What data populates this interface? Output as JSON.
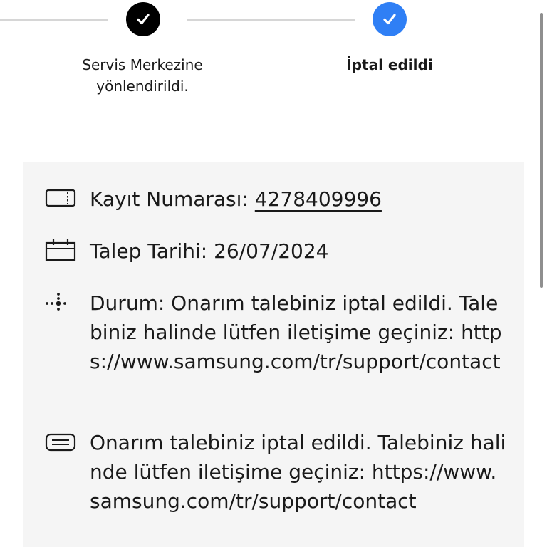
{
  "steps": [
    {
      "label_line1": "Servis Merkezine",
      "label_line2": "yönlendirildi.",
      "status": "completed"
    },
    {
      "label": "İptal edildi",
      "status": "current"
    }
  ],
  "info": {
    "record_label": "Kayıt Numarası: ",
    "record_number": "4278409996",
    "request_date": "Talep Tarihi: 26/07/2024",
    "status_text": "Durum: Onarım talebiniz iptal edildi. Talebiniz halinde lütfen iletişime geçiniz: https://www.samsung.com/tr/support/contact",
    "message_text": "Onarım talebiniz iptal edildi. Talebiniz halinde lütfen iletişime geçiniz: https://www.samsung.com/tr/support/contact"
  },
  "icons": [
    "ticket-icon",
    "calendar-icon",
    "status-dots-icon",
    "message-icon",
    "check-icon"
  ],
  "colors": {
    "done_step": "#000000",
    "current_step": "#2f7ff5",
    "panel_bg": "#f5f5f5",
    "connector": "#d6d6d6"
  }
}
